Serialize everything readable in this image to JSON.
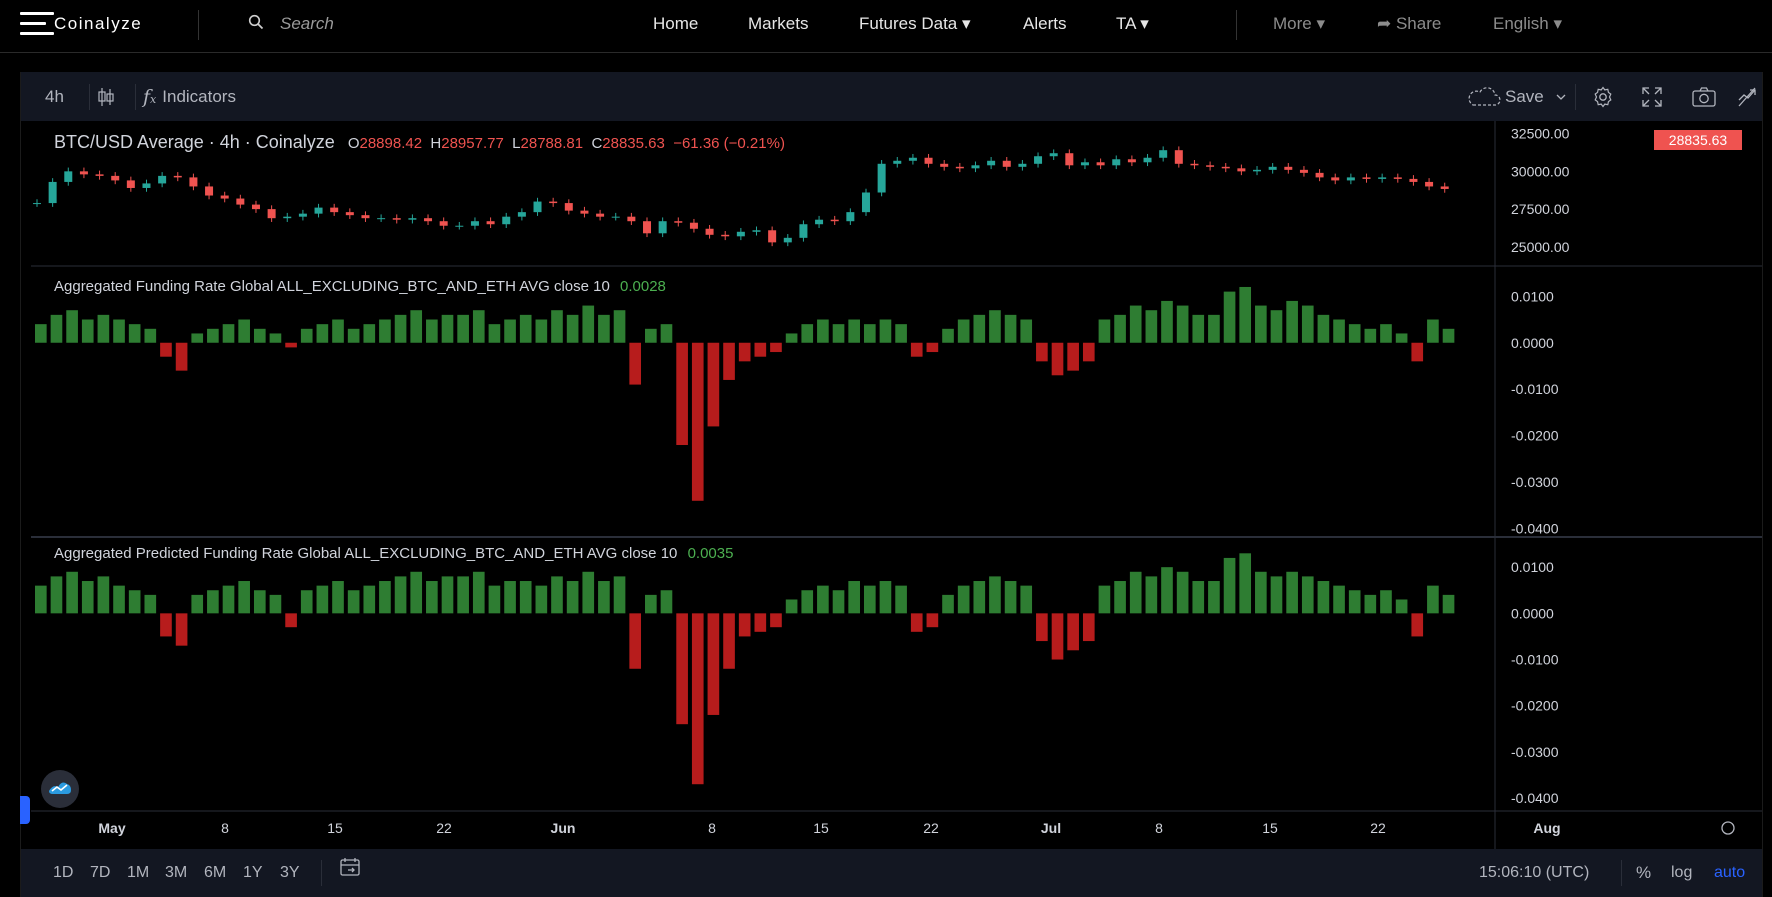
{
  "nav": {
    "brand": "Coinalyze",
    "search_placeholder": "Search",
    "home": "Home",
    "markets": "Markets",
    "futures": "Futures Data ▾",
    "alerts": "Alerts",
    "ta": "TA ▾",
    "more": "More ▾",
    "share": "➦ Share",
    "language": "English ▾"
  },
  "toolbar": {
    "interval": "4h",
    "indicators": "Indicators",
    "save": "Save"
  },
  "main": {
    "symbol": "BTC/USD Average · 4h · Coinalyze",
    "o_label": "O",
    "o_value": "28898.42",
    "h_label": "H",
    "h_value": "28957.77",
    "l_label": "L",
    "l_value": "28788.81",
    "c_label": "C",
    "c_value": "28835.63",
    "change": "−61.36 (−0.21%)",
    "last_price": "28835.63"
  },
  "pane2": {
    "title": "Aggregated Funding Rate Global ALL_EXCLUDING_BTC_AND_ETH AVG close 10",
    "value": "0.0028"
  },
  "pane3": {
    "title": "Aggregated Predicted Funding Rate Global ALL_EXCLUDING_BTC_AND_ETH AVG close 10",
    "value": "0.0035"
  },
  "bottom": {
    "ranges": [
      "1D",
      "7D",
      "1M",
      "3M",
      "6M",
      "1Y",
      "3Y"
    ],
    "clock": "15:06:10 (UTC)",
    "pct": "%",
    "log": "log",
    "auto": "auto"
  },
  "colors": {
    "up": "#26a69a",
    "down": "#ef5350",
    "hist_pos": "#2e7d32",
    "hist_neg": "#b71c1c",
    "accent": "#2962ff",
    "toolbar_bg": "#131722"
  },
  "chart_data": [
    {
      "type": "candlestick",
      "title": "BTC/USD Average · 4h · Coinalyze",
      "x_ticks": [
        "May",
        "8",
        "15",
        "22",
        "Jun",
        "8",
        "15",
        "22",
        "Jul",
        "8",
        "15",
        "22",
        "Aug"
      ],
      "y_ticks": [
        "32500.00",
        "30000.00",
        "27500.00",
        "25000.00"
      ],
      "ylim": [
        24000,
        33200
      ],
      "series": [
        {
          "values": [
            27900,
            29300,
            30000,
            29800,
            29700,
            29400,
            28900,
            29200,
            29700,
            29600,
            29000,
            28400,
            28200,
            27800,
            27500,
            26900,
            27000,
            27200,
            27600,
            27300,
            27100,
            26900,
            26900,
            26800,
            26900,
            26700,
            26400,
            26400,
            26700,
            26500,
            27000,
            27300,
            28000,
            27900,
            27400,
            27200,
            27000,
            27000,
            26700,
            25900,
            26700,
            26600,
            26200,
            25800,
            25700,
            26000,
            26100,
            25300,
            25600,
            26500,
            26800,
            26700,
            27300,
            28600,
            30500,
            30700,
            30900,
            30500,
            30300,
            30200,
            30400,
            30700,
            30300,
            30500,
            31000,
            31200,
            30400,
            30600,
            30400,
            30800,
            30600,
            30900,
            31400,
            30500,
            30400,
            30300,
            30200,
            30000,
            30100,
            30300,
            30100,
            29900,
            29600,
            29400,
            29600,
            29500,
            29600,
            29500,
            29300,
            29000,
            28835
          ]
        }
      ],
      "last": 28835.63
    },
    {
      "type": "bar",
      "title": "Aggregated Funding Rate Global ALL_EXCLUDING_BTC_AND_ETH AVG close 10",
      "y_ticks": [
        "0.0100",
        "0.0000",
        "-0.0100",
        "-0.0200",
        "-0.0300",
        "-0.0400"
      ],
      "ylim": [
        -0.0405,
        0.0135
      ],
      "series": [
        {
          "values": [
            0.004,
            0.006,
            0.007,
            0.005,
            0.006,
            0.005,
            0.004,
            0.003,
            -0.003,
            -0.006,
            0.002,
            0.003,
            0.004,
            0.005,
            0.003,
            0.002,
            -0.001,
            0.003,
            0.004,
            0.005,
            0.003,
            0.004,
            0.005,
            0.006,
            0.007,
            0.005,
            0.006,
            0.006,
            0.007,
            0.004,
            0.005,
            0.006,
            0.005,
            0.007,
            0.006,
            0.008,
            0.006,
            0.007,
            -0.009,
            0.003,
            0.004,
            -0.022,
            -0.034,
            -0.018,
            -0.008,
            -0.004,
            -0.003,
            -0.002,
            0.002,
            0.004,
            0.005,
            0.004,
            0.005,
            0.004,
            0.005,
            0.004,
            -0.003,
            -0.002,
            0.003,
            0.005,
            0.006,
            0.007,
            0.006,
            0.005,
            -0.004,
            -0.007,
            -0.006,
            -0.004,
            0.005,
            0.006,
            0.008,
            0.007,
            0.009,
            0.008,
            0.006,
            0.006,
            0.011,
            0.012,
            0.008,
            0.007,
            0.009,
            0.008,
            0.006,
            0.005,
            0.004,
            0.003,
            0.004,
            0.002,
            -0.004,
            0.005,
            0.003
          ]
        }
      ]
    },
    {
      "type": "bar",
      "title": "Aggregated Predicted Funding Rate Global ALL_EXCLUDING_BTC_AND_ETH AVG close 10",
      "y_ticks": [
        "0.0100",
        "0.0000",
        "-0.0100",
        "-0.0200",
        "-0.0300",
        "-0.0400"
      ],
      "ylim": [
        -0.0415,
        0.0135
      ],
      "series": [
        {
          "values": [
            0.006,
            0.008,
            0.009,
            0.007,
            0.008,
            0.006,
            0.005,
            0.004,
            -0.005,
            -0.007,
            0.004,
            0.005,
            0.006,
            0.007,
            0.005,
            0.004,
            -0.003,
            0.005,
            0.006,
            0.007,
            0.005,
            0.006,
            0.007,
            0.008,
            0.009,
            0.007,
            0.008,
            0.008,
            0.009,
            0.006,
            0.007,
            0.007,
            0.006,
            0.008,
            0.007,
            0.009,
            0.007,
            0.008,
            -0.012,
            0.004,
            0.005,
            -0.024,
            -0.037,
            -0.022,
            -0.012,
            -0.005,
            -0.004,
            -0.003,
            0.003,
            0.005,
            0.006,
            0.005,
            0.007,
            0.006,
            0.007,
            0.006,
            -0.004,
            -0.003,
            0.004,
            0.006,
            0.007,
            0.008,
            0.007,
            0.006,
            -0.006,
            -0.01,
            -0.008,
            -0.006,
            0.006,
            0.007,
            0.009,
            0.008,
            0.01,
            0.009,
            0.007,
            0.007,
            0.012,
            0.013,
            0.009,
            0.008,
            0.009,
            0.008,
            0.007,
            0.006,
            0.005,
            0.004,
            0.005,
            0.003,
            -0.005,
            0.006,
            0.004
          ]
        }
      ]
    }
  ]
}
